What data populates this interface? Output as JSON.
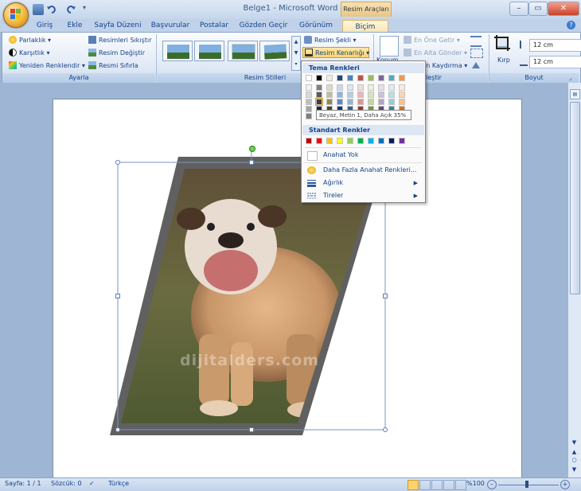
{
  "window": {
    "title": "Belge1 - Microsoft Word",
    "context_group": "Resim Araçları"
  },
  "tabs": [
    "Giriş",
    "Ekle",
    "Sayfa Düzeni",
    "Başvurular",
    "Postalar",
    "Gözden Geçir",
    "Görünüm",
    "Biçim"
  ],
  "active_tab": "Biçim",
  "ribbon": {
    "ayarla": {
      "label": "Ayarla",
      "parlaklik": "Parlaklık",
      "karsitlik": "Karşıtlık",
      "yeniden_renklendir": "Yeniden Renklendir",
      "sikistir": "Resimleri Sıkıştır",
      "degistir": "Resim Değiştir",
      "sifirla": "Resmi Sıfırla"
    },
    "resim_stilleri": {
      "label": "Resim Stilleri",
      "resim_sekli": "Resim Şekli",
      "resim_kenarligi": "Resim Kenarlığı"
    },
    "yerlestir": {
      "label_suffix": "leştir",
      "konum": "Konum",
      "en_one_getir": "En Öne Getir",
      "en_alta_gonder": "En Alta Gönder",
      "metin_kaydirma_suffix": "in Kaydırma"
    },
    "boyut": {
      "label": "Boyut",
      "kirp": "Kırp",
      "height": "12 cm",
      "width": "12 cm"
    }
  },
  "dropdown": {
    "tema_renkleri": "Tema Renkleri",
    "standart_renkler": "Standart Renkler",
    "tooltip": "Beyaz, Metin 1, Daha Açık 35%",
    "anahat_yok": "Anahat Yok",
    "daha_fazla": "Daha Fazla Anahat Renkleri...",
    "agirlik": "Ağırlık",
    "tireler": "Tireler",
    "theme_top": [
      "#ffffff",
      "#000000",
      "#eeece1",
      "#1f497d",
      "#4f81bd",
      "#c0504d",
      "#9bbb59",
      "#8064a2",
      "#4bacc6",
      "#f79646"
    ],
    "theme_shades": [
      [
        "#f2f2f2",
        "#7f7f7f",
        "#ddd9c3",
        "#c6d9f0",
        "#dbe5f1",
        "#f2dcdb",
        "#ebf1dd",
        "#e5e0ec",
        "#dbeef3",
        "#fdeada"
      ],
      [
        "#d8d8d8",
        "#595959",
        "#c4bd97",
        "#8db3e2",
        "#b8cce4",
        "#e5b9b7",
        "#d7e3bc",
        "#ccc1d9",
        "#b7dde8",
        "#fbd5b5"
      ],
      [
        "#bfbfbf",
        "#3f3f3f",
        "#938953",
        "#548dd4",
        "#95b3d7",
        "#d99694",
        "#c3d69b",
        "#b2a2c7",
        "#92cddc",
        "#fac08f"
      ],
      [
        "#a5a5a5",
        "#262626",
        "#494429",
        "#17365d",
        "#366092",
        "#953734",
        "#76923c",
        "#5f497a",
        "#31859b",
        "#e36c09"
      ],
      [
        "#7f7f7f",
        "#0c0c0c",
        "#1d1b10",
        "#0f243e",
        "#244061",
        "#632423",
        "#4f6128",
        "#3f3151",
        "#205867",
        "#974806"
      ]
    ],
    "standard": [
      "#c00000",
      "#ff0000",
      "#ffc000",
      "#ffff00",
      "#92d050",
      "#00b050",
      "#00b0f0",
      "#0070c0",
      "#002060",
      "#7030a0"
    ]
  },
  "document": {
    "watermark": "dijitalders.com"
  },
  "statusbar": {
    "page": "Sayfa: 1 / 1",
    "words": "Sözcük: 0",
    "language": "Türkçe",
    "zoom": "%100"
  }
}
